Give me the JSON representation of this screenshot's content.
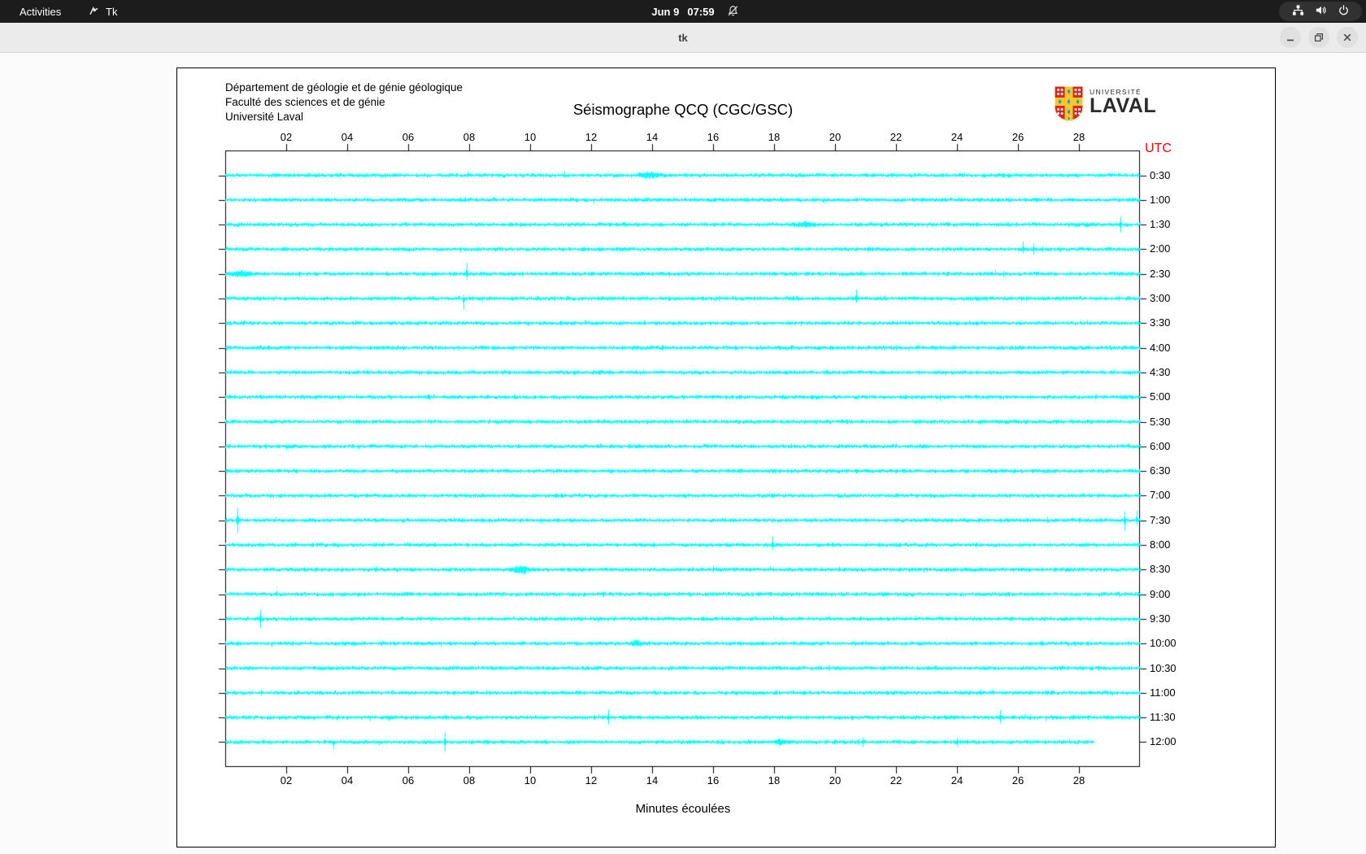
{
  "top_bar": {
    "activities": "Activities",
    "app_name": "Tk",
    "clock": {
      "date": "Jun 9",
      "time": "07:59"
    },
    "right_icons": [
      "network-icon",
      "volume-icon",
      "power-icon"
    ]
  },
  "window": {
    "title": "tk",
    "buttons": [
      "minimize",
      "restore",
      "close"
    ]
  },
  "seismograph": {
    "header_lines": [
      "Département de géologie et de génie géologique",
      "Faculté des sciences et de génie",
      "Université Laval"
    ],
    "title": "Séismographe QCQ (CGC/GSC)",
    "logo": {
      "line1": "UNIVERSITÉ",
      "line2": "LAVAL"
    },
    "utc_label": "UTC",
    "xlabel": "Minutes écoulées",
    "trace_color": "#00ffff",
    "utc_color": "#f20000",
    "logo_colors": {
      "red": "#da291c",
      "gold": "#ffc72c",
      "blue": "#009fdf"
    }
  },
  "chart_data": {
    "type": "line",
    "subtype": "helicorder-seismogram",
    "title": "Séismographe QCQ (CGC/GSC)",
    "xlabel": "Minutes écoulées",
    "xlim": [
      0,
      30
    ],
    "x_tick_minutes": [
      2,
      4,
      6,
      8,
      10,
      12,
      14,
      16,
      18,
      20,
      22,
      24,
      26,
      28
    ],
    "x_tick_labels": [
      "02",
      "04",
      "06",
      "08",
      "10",
      "12",
      "14",
      "16",
      "18",
      "20",
      "22",
      "24",
      "26",
      "28"
    ],
    "right_axis_label": "UTC",
    "rows": [
      {
        "label": "0:30",
        "bursts": [
          {
            "m": 13.9,
            "w": 0.5,
            "a": 2.5
          }
        ]
      },
      {
        "label": "1:00"
      },
      {
        "label": "1:30",
        "bursts": [
          {
            "m": 19.0,
            "w": 0.4,
            "a": 2.0
          }
        ],
        "spikes": [
          {
            "m": 29.35,
            "u": 10,
            "d": 10
          }
        ]
      },
      {
        "label": "2:00",
        "spikes": [
          {
            "m": 26.15,
            "u": 9,
            "d": 5
          },
          {
            "m": 26.5,
            "u": 7,
            "d": 7
          }
        ]
      },
      {
        "label": "2:30",
        "bursts": [
          {
            "m": 0.5,
            "w": 0.5,
            "a": 2.5
          }
        ],
        "spikes": [
          {
            "m": 7.93,
            "u": 14,
            "d": 7
          }
        ]
      },
      {
        "label": "3:00",
        "spikes": [
          {
            "m": 7.8,
            "u": 4,
            "d": 14
          },
          {
            "m": 20.7,
            "u": 11,
            "d": 5
          }
        ]
      },
      {
        "label": "3:30"
      },
      {
        "label": "4:00"
      },
      {
        "label": "4:30"
      },
      {
        "label": "5:00"
      },
      {
        "label": "5:30"
      },
      {
        "label": "6:00"
      },
      {
        "label": "6:30"
      },
      {
        "label": "7:00"
      },
      {
        "label": "7:30",
        "spikes": [
          {
            "m": 0.4,
            "u": 15,
            "d": 15
          },
          {
            "m": 29.5,
            "u": 11,
            "d": 13
          },
          {
            "m": 29.9,
            "u": 12,
            "d": 6
          }
        ]
      },
      {
        "label": "8:00",
        "spikes": [
          {
            "m": 17.95,
            "u": 11,
            "d": 6
          }
        ]
      },
      {
        "label": "8:30",
        "bursts": [
          {
            "m": 9.7,
            "w": 0.4,
            "a": 3.5
          }
        ]
      },
      {
        "label": "9:00"
      },
      {
        "label": "9:30",
        "spikes": [
          {
            "m": 1.15,
            "u": 11,
            "d": 11
          }
        ]
      },
      {
        "label": "10:00",
        "bursts": [
          {
            "m": 13.5,
            "w": 0.3,
            "a": 2.5
          }
        ]
      },
      {
        "label": "10:30"
      },
      {
        "label": "11:00"
      },
      {
        "label": "11:30",
        "spikes": [
          {
            "m": 12.55,
            "u": 10,
            "d": 9
          },
          {
            "m": 25.4,
            "u": 9,
            "d": 7
          }
        ]
      },
      {
        "label": "12:00",
        "end_minute": 28.5,
        "bursts": [
          {
            "m": 18.2,
            "w": 0.3,
            "a": 2.0
          }
        ],
        "spikes": [
          {
            "m": 3.55,
            "u": 2,
            "d": 9
          },
          {
            "m": 7.2,
            "u": 12,
            "d": 12
          },
          {
            "m": 20.9,
            "u": 6,
            "d": 6
          },
          {
            "m": 24.0,
            "u": 5,
            "d": 5
          }
        ]
      }
    ]
  }
}
